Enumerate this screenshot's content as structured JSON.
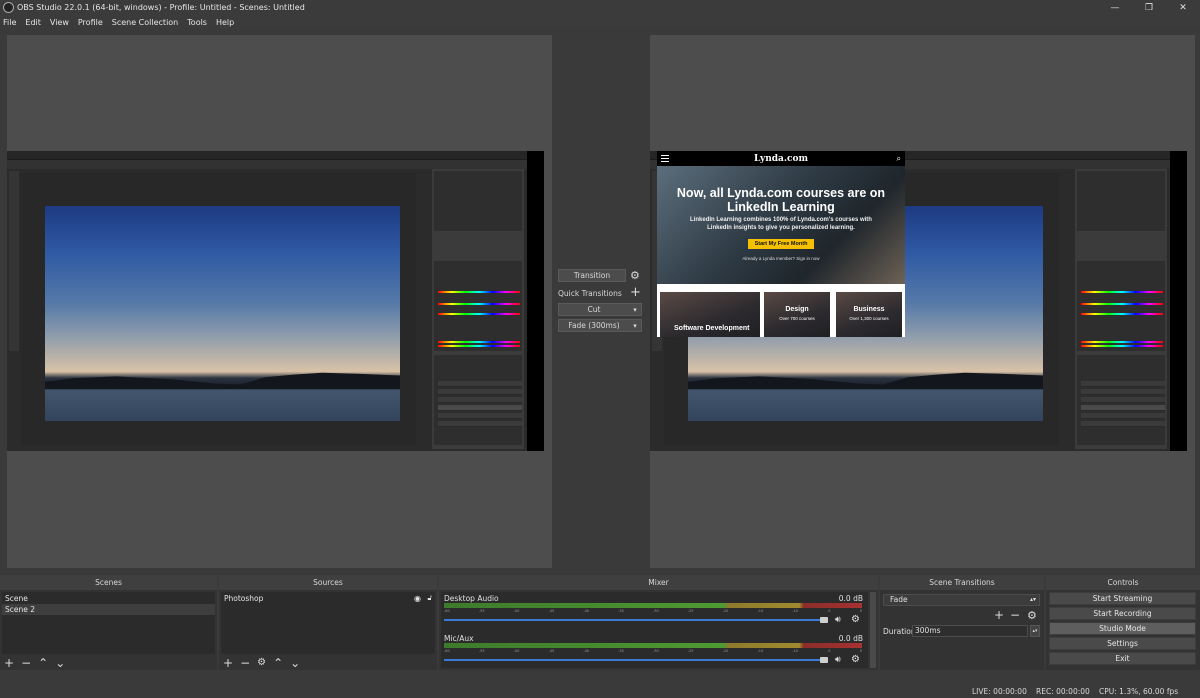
{
  "window": {
    "title": "OBS Studio 22.0.1 (64-bit, windows) - Profile: Untitled - Scenes: Untitled",
    "minimize": "—",
    "maximize": "❐",
    "close": "✕"
  },
  "menu": [
    "File",
    "Edit",
    "View",
    "Profile",
    "Scene Collection",
    "Tools",
    "Help"
  ],
  "lynda_overlay": {
    "logo": "Lynda.com",
    "headline": "Now, all Lynda.com courses are on LinkedIn Learning",
    "subtext": "LinkedIn Learning combines 100% of Lynda.com's courses with LinkedIn insights to give you personalized learning.",
    "cta": "Start My Free Month",
    "signin": "Already a Lynda member? Sign in now",
    "cards": [
      {
        "title": "Software Development",
        "subtitle": ""
      },
      {
        "title": "Design",
        "subtitle": "Over 700 courses"
      },
      {
        "title": "Business",
        "subtitle": "Over 1,300 courses"
      }
    ]
  },
  "transition_controls": {
    "transition_button": "Transition",
    "quick_transitions_label": "Quick Transitions",
    "cut": "Cut",
    "fade": "Fade (300ms)"
  },
  "scenes": {
    "header": "Scenes",
    "items": [
      "Scene",
      "Scene 2"
    ],
    "selected_index": 1
  },
  "sources": {
    "header": "Sources",
    "items": [
      "Photoshop"
    ]
  },
  "mixer": {
    "header": "Mixer",
    "ticks": [
      "-60",
      "-55",
      "-50",
      "-45",
      "-40",
      "-35",
      "-30",
      "-25",
      "-20",
      "-15",
      "-10",
      "-5",
      "0"
    ],
    "channels": [
      {
        "name": "Desktop Audio",
        "db": "0.0 dB",
        "volume": 1.0
      },
      {
        "name": "Mic/Aux",
        "db": "0.0 dB",
        "volume": 1.0
      }
    ]
  },
  "scene_transitions": {
    "header": "Scene Transitions",
    "selected": "Fade",
    "duration_label": "Duration",
    "duration_value": "300ms"
  },
  "controls": {
    "header": "Controls",
    "buttons": [
      "Start Streaming",
      "Start Recording",
      "Studio Mode",
      "Settings",
      "Exit"
    ],
    "active_index": 2
  },
  "status": {
    "live": "LIVE: 00:00:00",
    "rec": "REC: 00:00:00",
    "cpu": "CPU: 1.3%, 60.00 fps"
  },
  "icons": {
    "gear": "gear-icon",
    "plus": "plus-icon",
    "minus": "minus-icon",
    "up": "arrow-up-icon",
    "down": "arrow-down-icon",
    "eye": "eye-icon",
    "lock": "lock-icon",
    "speaker": "speaker-icon"
  }
}
